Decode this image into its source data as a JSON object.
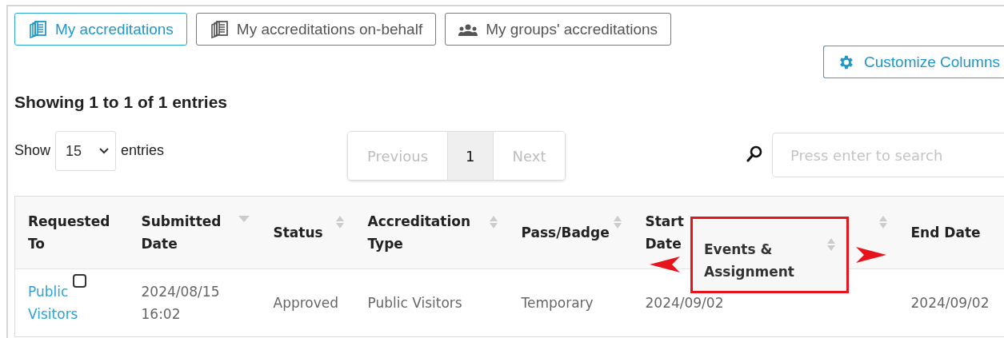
{
  "tabs": [
    {
      "label": "My accreditations",
      "kind": "documents",
      "selected": true
    },
    {
      "label": "My accreditations on-behalf",
      "kind": "documents",
      "selected": false
    },
    {
      "label": "My groups' accreditations",
      "kind": "group",
      "selected": false
    }
  ],
  "customize_button": {
    "label": "Customize Columns"
  },
  "summary": "Showing 1 to 1 of 1 entries",
  "length_menu": {
    "before": "Show",
    "value": "15",
    "after": "entries"
  },
  "pagination": [
    {
      "label": "Previous",
      "kind": "nav",
      "disabled": true,
      "selected": false
    },
    {
      "label": "1",
      "kind": "page",
      "disabled": false,
      "selected": true
    },
    {
      "label": "Next",
      "kind": "nav",
      "disabled": true,
      "selected": false
    }
  ],
  "search": {
    "placeholder": "Press enter to search"
  },
  "table": {
    "columns": [
      {
        "label": "Requested To"
      },
      {
        "label": "Submitted Date",
        "sortable": true,
        "sorted": true
      },
      {
        "label": "Status",
        "sortable": true,
        "sorted": false
      },
      {
        "label": "Accreditation Type",
        "sortable": true,
        "sorted": false
      },
      {
        "label": "Pass/Badge",
        "sortable": true,
        "sorted": false
      },
      {
        "label": "Start Date"
      },
      {
        "sortable": true,
        "sorted": false
      },
      {
        "label": "End Date"
      }
    ],
    "rows": [
      {
        "cells": [
          {
            "text": "Public Visitors",
            "kind": "link",
            "checked": false
          },
          {
            "text": "2024/08/15 16:02"
          },
          {
            "text": "Approved"
          },
          {
            "text": "Public Visitors"
          },
          {
            "text": "Temporary"
          },
          {
            "text": "2024/09/02"
          },
          {},
          {
            "text": "2024/09/02"
          }
        ]
      }
    ]
  },
  "dragged_column": {
    "label": "Events & Assignment",
    "sortable": true,
    "sorted": false
  }
}
